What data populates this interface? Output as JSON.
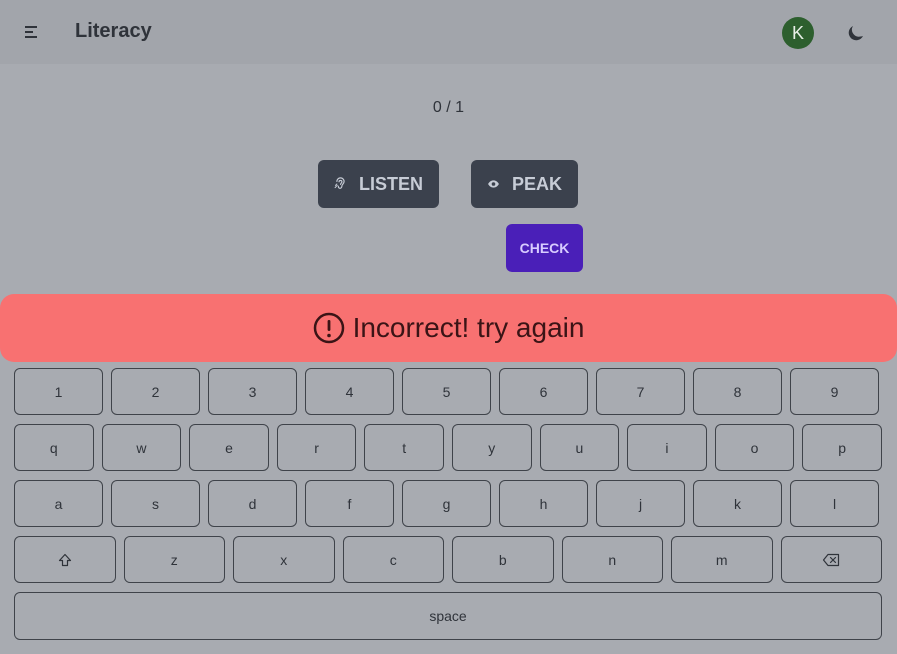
{
  "header": {
    "title": "Literacy",
    "avatar_initial": "K",
    "menu_icon": "menu-icon",
    "theme_icon": "moon-icon"
  },
  "progress": {
    "text": "0 / 1"
  },
  "actions": {
    "listen_label": "LISTEN",
    "listen_icon": "ear-icon",
    "peak_label": "PEAK",
    "peak_icon": "eye-icon",
    "check_label": "CHECK"
  },
  "alert": {
    "icon": "alert-circle-icon",
    "message": "Incorrect! try again"
  },
  "keyboard": {
    "row1": [
      "1",
      "2",
      "3",
      "4",
      "5",
      "6",
      "7",
      "8",
      "9"
    ],
    "row2": [
      "q",
      "w",
      "e",
      "r",
      "t",
      "y",
      "u",
      "i",
      "o",
      "p"
    ],
    "row3": [
      "a",
      "s",
      "d",
      "f",
      "g",
      "h",
      "j",
      "k",
      "l"
    ],
    "row4": [
      "z",
      "x",
      "c",
      "b",
      "n",
      "m"
    ],
    "shift_icon": "shift-icon",
    "backspace_icon": "backspace-icon",
    "space_label": "space"
  },
  "colors": {
    "background": "#a8abb1",
    "topbar": "#a2a5ab",
    "action_button": "#3b414d",
    "check_button": "#4a1fb8",
    "alert": "#f87171",
    "avatar": "#2d5f2e"
  }
}
